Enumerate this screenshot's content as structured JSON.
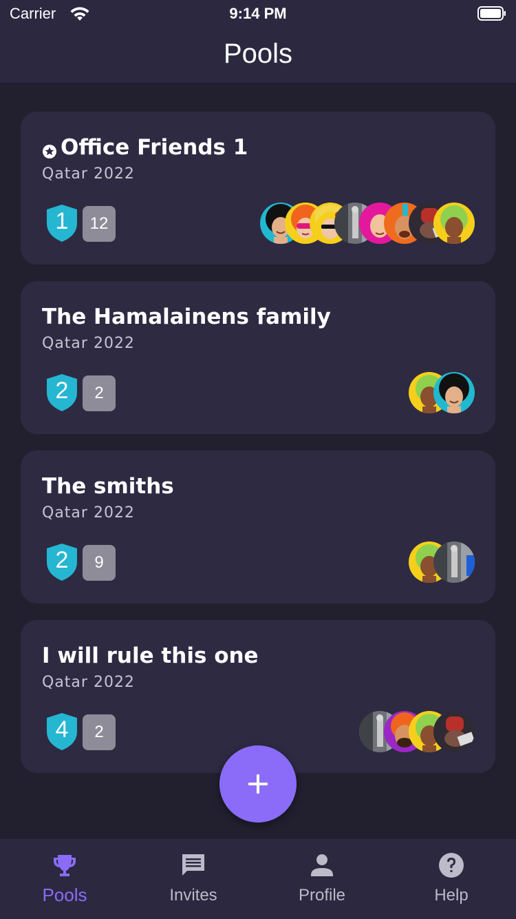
{
  "status_bar": {
    "carrier": "Carrier",
    "time": "9:14 PM"
  },
  "header": {
    "title": "Pools"
  },
  "colors": {
    "accent": "#8a6cf8",
    "shield": "#25b6d2",
    "card": "#2d2a42",
    "background": "#22202f"
  },
  "pools": [
    {
      "title": "Office Friends 1",
      "favorite": true,
      "subtitle": "Qatar 2022",
      "rank": "1",
      "members": "12",
      "avatars": [
        "afro-black-avatar",
        "afro-orange-sunglasses-avatar",
        "yellow-hair-sunglasses-avatar",
        "photo-avatar",
        "pink-hair-avatar",
        "mohawk-avatar",
        "photo-red-avatar",
        "yellow-bg-avatar"
      ]
    },
    {
      "title": "The Hamalainens family",
      "favorite": false,
      "subtitle": "Qatar 2022",
      "rank": "2",
      "members": "2",
      "avatars": [
        "yellow-bg-avatar",
        "afro-black-avatar"
      ]
    },
    {
      "title": "The smiths",
      "favorite": false,
      "subtitle": "Qatar 2022",
      "rank": "2",
      "members": "9",
      "avatars": [
        "yellow-bg-avatar",
        "photo-avatar"
      ]
    },
    {
      "title": "I will rule this one",
      "favorite": false,
      "subtitle": "Qatar 2022",
      "rank": "4",
      "members": "2",
      "avatars": [
        "photo-avatar",
        "purple-beard-avatar",
        "yellow-bg-avatar",
        "photo-red-avatar"
      ]
    }
  ],
  "fab": {
    "icon": "plus-icon"
  },
  "tabs": [
    {
      "label": "Pools",
      "icon": "trophy-icon",
      "active": true
    },
    {
      "label": "Invites",
      "icon": "message-icon",
      "active": false
    },
    {
      "label": "Profile",
      "icon": "person-icon",
      "active": false
    },
    {
      "label": "Help",
      "icon": "help-icon",
      "active": false
    }
  ]
}
